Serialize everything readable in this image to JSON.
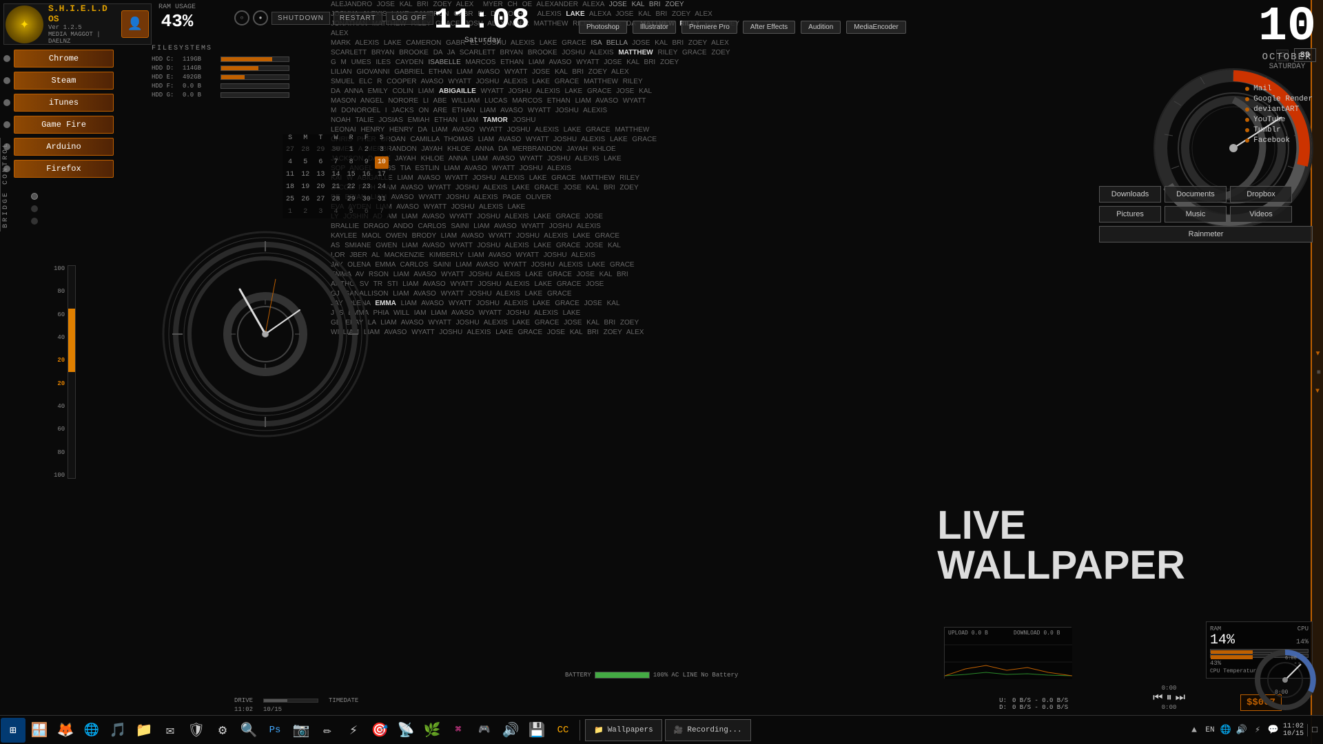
{
  "os": {
    "name": "S.H.I.E.L.D OS",
    "version": "Ver 1.2.5",
    "user1": "MEDIA MAGGOT",
    "user2": "DAELNZ"
  },
  "ram": {
    "label": "RAM USAGE",
    "value": "43%"
  },
  "buttons": {
    "shutdown": "SHUTDOWN",
    "restart": "RESTART",
    "logoff": "LOG OFF"
  },
  "clock": {
    "time": "11:08",
    "day": "Saturday"
  },
  "date": {
    "day_num": "10",
    "month": "OCTOBER",
    "weekday": "SATURDAY"
  },
  "apps_top": {
    "photoshop": "Photoshop",
    "illustrator": "Illustrator",
    "premiere": "Premiere Pro",
    "after_effects": "After Effects",
    "audition": "Audition",
    "media_encoder": "MediaEncoder"
  },
  "sidebar": {
    "items": [
      {
        "label": "Chrome"
      },
      {
        "label": "Steam"
      },
      {
        "label": "iTunes"
      },
      {
        "label": "Game Fire"
      },
      {
        "label": "Arduino"
      },
      {
        "label": "Firefox"
      }
    ]
  },
  "filesystem": {
    "title": "FILESYSTEMS",
    "drives": [
      {
        "label": "HDD C:",
        "size": "119GB",
        "fill": 75
      },
      {
        "label": "HDD D:",
        "size": "114GB",
        "fill": 55
      },
      {
        "label": "HDD E:",
        "size": "492GB",
        "fill": 35
      },
      {
        "label": "HDD F:",
        "size": "0.0 B",
        "fill": 0
      },
      {
        "label": "HDD G:",
        "size": "0.0 B",
        "fill": 0
      }
    ]
  },
  "calendar": {
    "days_header": [
      "S",
      "M",
      "T",
      "W",
      "R",
      "F",
      "S"
    ],
    "weeks": [
      [
        {
          "n": "27",
          "dim": true
        },
        {
          "n": "28",
          "dim": true
        },
        {
          "n": "29",
          "dim": true
        },
        {
          "n": "30",
          "dim": true
        },
        {
          "n": "1"
        },
        {
          "n": "2"
        },
        {
          "n": "3"
        }
      ],
      [
        {
          "n": "4"
        },
        {
          "n": "5"
        },
        {
          "n": "6"
        },
        {
          "n": "7"
        },
        {
          "n": "8"
        },
        {
          "n": "9"
        },
        {
          "n": "10",
          "today": true
        }
      ],
      [
        {
          "n": "11"
        },
        {
          "n": "12"
        },
        {
          "n": "13"
        },
        {
          "n": "14"
        },
        {
          "n": "15"
        },
        {
          "n": "16"
        },
        {
          "n": "17"
        }
      ],
      [
        {
          "n": "18"
        },
        {
          "n": "19"
        },
        {
          "n": "20"
        },
        {
          "n": "21"
        },
        {
          "n": "22"
        },
        {
          "n": "23"
        },
        {
          "n": "24"
        }
      ],
      [
        {
          "n": "25"
        },
        {
          "n": "26"
        },
        {
          "n": "27"
        },
        {
          "n": "28"
        },
        {
          "n": "29"
        },
        {
          "n": "30"
        },
        {
          "n": "31"
        }
      ],
      [
        {
          "n": "1",
          "dim": true
        },
        {
          "n": "2",
          "dim": true
        },
        {
          "n": "3",
          "dim": true
        },
        {
          "n": "4",
          "dim": true
        },
        {
          "n": "5",
          "dim": true
        },
        {
          "n": "6",
          "dim": true
        },
        {
          "n": "7",
          "dim": true
        }
      ]
    ]
  },
  "links": [
    {
      "label": "Mail"
    },
    {
      "label": "Google Render"
    },
    {
      "label": "deviantART"
    },
    {
      "label": "YouTube"
    },
    {
      "label": "Tumblr"
    },
    {
      "label": "Facebook"
    }
  ],
  "folders": [
    {
      "label": "Downloads"
    },
    {
      "label": "Documents"
    },
    {
      "label": "Dropbox"
    },
    {
      "label": "Pictures"
    },
    {
      "label": "Music"
    },
    {
      "label": "Videos"
    },
    {
      "label": "Rainmeter"
    }
  ],
  "live_wallpaper": {
    "line1": "LIVE",
    "line2": "WALLPAPER"
  },
  "network": {
    "upload": "0 B/S",
    "download": "0 B/S",
    "upload_label": "U:",
    "download_label": "D:"
  },
  "cpu": {
    "label": "CPU",
    "ram_label": "RAM",
    "ram_value": "14%",
    "value": "43%"
  },
  "battery": {
    "label": "BATTERY",
    "value": "100%",
    "ac": "AC LINE"
  },
  "media": {
    "time_start": "0:00",
    "time_end": "0:00"
  },
  "taskbar": {
    "icons": [
      "🪟",
      "🦊",
      "🌐",
      "🎵",
      "📁",
      "📧",
      "🛡",
      "⚙",
      "🔍",
      "🎨",
      "📸",
      "✏",
      "⚡",
      "🎯",
      "📡",
      "🌿"
    ],
    "wallpapers_label": "Wallpapers",
    "recording_label": "Recording...",
    "time": "11:02",
    "date": "10/15"
  },
  "score": "$$007",
  "gauge_value": "89"
}
